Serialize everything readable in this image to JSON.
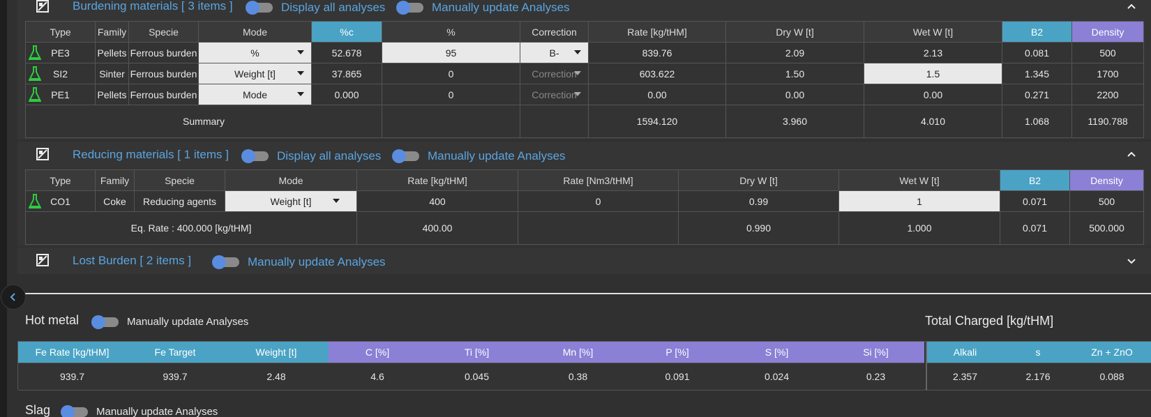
{
  "burdening": {
    "title": "Burdening materials [ 3 items ]",
    "toggle1": "Display all analyses",
    "toggle2": "Manually update Analyses",
    "headers": [
      "Type",
      "Family",
      "Specie",
      "Mode",
      "%c",
      "%",
      "Correction",
      "Rate [kg/tHM]",
      "Dry W [t]",
      "Wet W [t]",
      "B2",
      "Density"
    ],
    "rows": [
      {
        "type": "PE3",
        "family": "Pellets",
        "specie": "Ferrous burden",
        "mode": "%",
        "pc": "52.678",
        "pct": "95",
        "correction": "B-",
        "rate": "839.76",
        "dry": "2.09",
        "wet": "2.13",
        "b2": "0.081",
        "density": "500"
      },
      {
        "type": "SI2",
        "family": "Sinter",
        "specie": "Ferrous burden",
        "mode": "Weight [t]",
        "pc": "37.865",
        "pct": "0",
        "correction": "Correction",
        "rate": "603.622",
        "dry": "1.50",
        "wet": "1.5",
        "b2": "1.345",
        "density": "1700"
      },
      {
        "type": "PE1",
        "family": "Pellets",
        "specie": "Ferrous burden",
        "mode": "Mode",
        "pc": "0.000",
        "pct": "0",
        "correction": "Correction",
        "rate": "0.00",
        "dry": "0.00",
        "wet": "0.00",
        "b2": "0.271",
        "density": "2200"
      }
    ],
    "summary": {
      "label": "Summary",
      "rate": "1594.120",
      "dry": "3.960",
      "wet": "4.010",
      "b2": "1.068",
      "density": "1190.788"
    }
  },
  "reducing": {
    "title": "Reducing materials [ 1 items ]",
    "toggle1": "Display all analyses",
    "toggle2": "Manually update Analyses",
    "headers": [
      "Type",
      "Family",
      "Specie",
      "Mode",
      "Rate [kg/tHM]",
      "Rate [Nm3/tHM]",
      "Dry W [t]",
      "Wet W [t]",
      "B2",
      "Density"
    ],
    "row": {
      "type": "CO1",
      "family": "Coke",
      "specie": "Reducing agents",
      "mode": "Weight [t]",
      "rate": "400",
      "rate_nm3": "0",
      "dry": "0.99",
      "wet": "1",
      "b2": "0.071",
      "density": "500"
    },
    "summary": {
      "label": "Eq. Rate : 400.000 [kg/tHM]",
      "rate": "400.00",
      "dry": "0.990",
      "wet": "1.000",
      "b2": "0.071",
      "density": "500.000"
    }
  },
  "lost": {
    "title": "Lost Burden [ 2 items ]",
    "toggle": "Manually update Analyses"
  },
  "hot_metal": {
    "title": "Hot metal",
    "toggle": "Manually update Analyses",
    "total_title": "Total Charged [kg/tHM]",
    "headers": [
      "Fe Rate [kg/tHM]",
      "Fe Target",
      "Weight [t]",
      "C [%]",
      "Ti [%]",
      "Mn [%]",
      "P [%]",
      "S [%]",
      "Si [%]"
    ],
    "values": [
      "939.7",
      "939.7",
      "2.48",
      "4.6",
      "0.045",
      "0.38",
      "0.091",
      "0.024",
      "0.23"
    ],
    "total_headers": [
      "Alkali",
      "s",
      "Zn + ZnO"
    ],
    "total_values": [
      "2.357",
      "2.176",
      "0.088"
    ]
  },
  "slag": {
    "title": "Slag",
    "toggle": "Manually update Analyses"
  },
  "colors": {
    "accent_blue": "#4aa3c4",
    "accent_purple": "#8c7fd6",
    "link_blue": "#5aa5e0",
    "flask_green": "#2ecc40"
  }
}
